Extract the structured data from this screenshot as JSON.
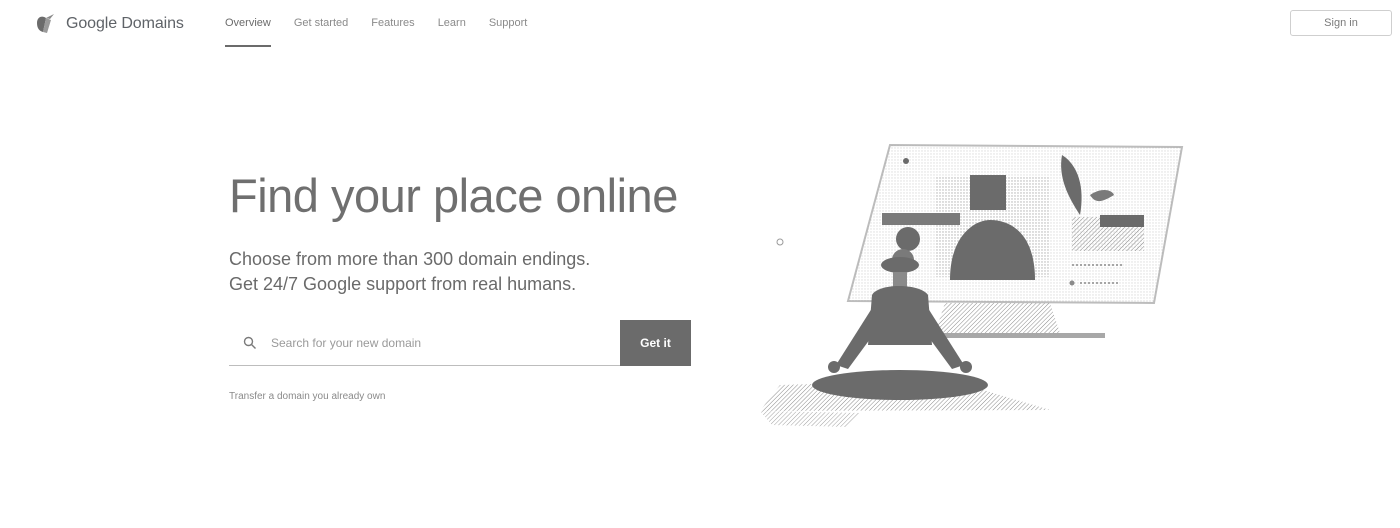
{
  "header": {
    "brand": "Google Domains",
    "nav": [
      {
        "label": "Overview",
        "active": true
      },
      {
        "label": "Get started",
        "active": false
      },
      {
        "label": "Features",
        "active": false
      },
      {
        "label": "Learn",
        "active": false
      },
      {
        "label": "Support",
        "active": false
      }
    ],
    "sign_in_label": "Sign in"
  },
  "hero": {
    "headline": "Find your place online",
    "subline_1": "Choose from more than 300 domain endings.",
    "subline_2": "Get 24/7 Google support from real humans.",
    "search_placeholder": "Search for your new domain",
    "search_value": "",
    "cta_label": "Get it",
    "transfer_link": "Transfer a domain you already own"
  },
  "icons": {
    "logo": "google-domains-logo-icon",
    "search": "search-icon"
  },
  "colors": {
    "primary_button": "#6b6b6b",
    "text": "#6f6f6f",
    "background": "#ffffff"
  }
}
